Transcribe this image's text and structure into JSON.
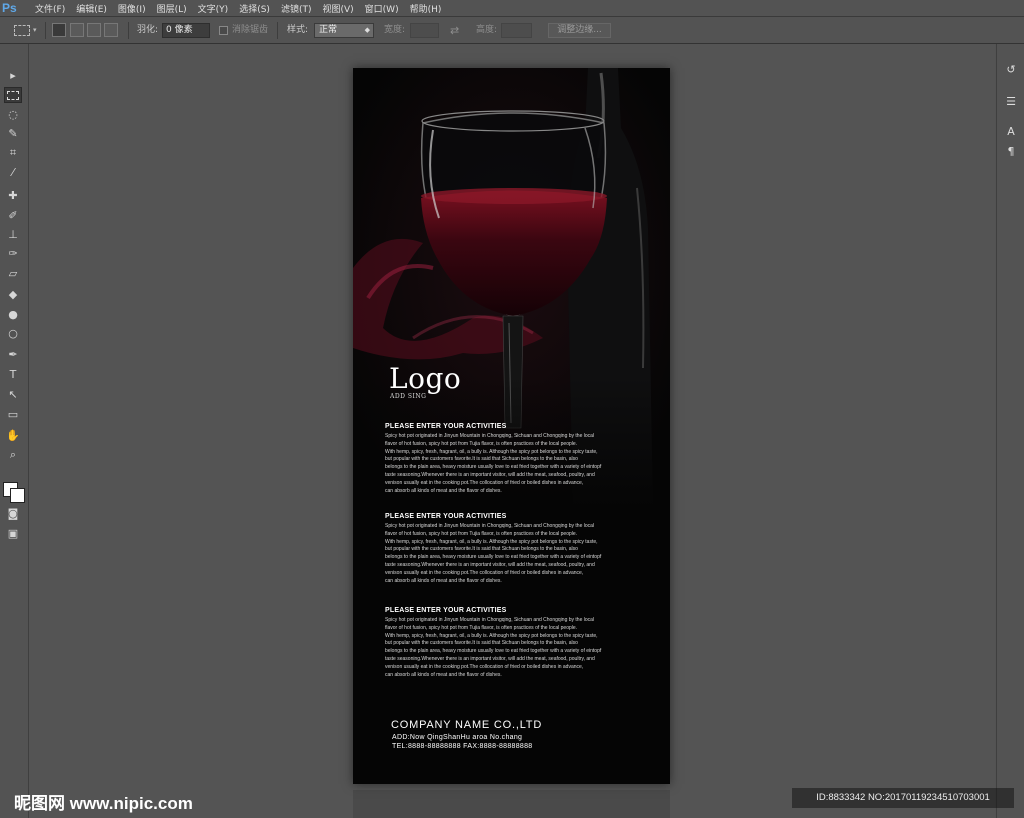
{
  "app": {
    "logo": "Ps"
  },
  "menu": [
    "文件(F)",
    "编辑(E)",
    "图像(I)",
    "图层(L)",
    "文字(Y)",
    "选择(S)",
    "滤镜(T)",
    "视图(V)",
    "窗口(W)",
    "帮助(H)"
  ],
  "options": {
    "feather_label": "羽化:",
    "feather_value": "0 像素",
    "antialias_label": "消除锯齿",
    "style_label": "样式:",
    "style_value": "正常",
    "width_label": "宽度:",
    "swap_icon": "⇄",
    "height_label": "高度:",
    "refine_edge_button": "调整边缘..."
  },
  "toolbar_icons": [
    "move-icon",
    "marquee-icon",
    "lasso-icon",
    "quick-select-icon",
    "crop-icon",
    "eyedropper-icon",
    "healing-brush-icon",
    "brush-icon",
    "clone-stamp-icon",
    "history-brush-icon",
    "eraser-icon",
    "paint-bucket-icon",
    "blur-icon",
    "dodge-icon",
    "pen-icon",
    "type-icon",
    "path-select-icon",
    "shape-icon",
    "hand-icon",
    "zoom-icon"
  ],
  "document": {
    "logo": "Logo",
    "logo_sub": "ADD SING",
    "blocks": [
      {
        "title": "PLEASE ENTER YOUR ACTIVITIES",
        "lines": [
          "Spicy hot pot originated in Jinyun Mountain in Chongqing, Sichuan and Chongqing by the local",
          "flavor of hot fusion, spicy hot pot from Tujia flavor, is often practices of the local people.",
          "With hemp, spicy, fresh, fragrant, oil, a bully is. Although the spicy pot belongs to the spicy taste,",
          "but popular with the customers favorite.It is said that Sichuan belongs to the basin, also",
          "belongs to the plain area, heavy moisture usually love to eat fried together with a variety of eintopf",
          "taste seasoning.Whenever there is an important visitor, will add the meat, seafood, poultry, and",
          "venison usually eat in the cooking pot.The collocation of fried or boiled dishes in advance,",
          "can absorb all kinds of meat and the flavor of dishes."
        ]
      },
      {
        "title": "PLEASE ENTER YOUR ACTIVITIES",
        "lines": [
          "Spicy hot pot originated in Jinyun Mountain in Chongqing, Sichuan and Chongqing by the local",
          "flavor of hot fusion, spicy hot pot from Tujia flavor, is often practices of the local people.",
          "With hemp, spicy, fresh, fragrant, oil, a bully is. Although the spicy pot belongs to the spicy taste,",
          "but popular with the customers favorite.It is said that Sichuan belongs to the basin, also",
          "belongs to the plain area, heavy moisture usually love to eat fried together with a variety of eintopf",
          "taste seasoning.Whenever there is an important visitor, will add the meat, seafood, poultry, and",
          "venison usually eat in the cooking pot.The collocation of fried or boiled dishes in advance,",
          "can absorb all kinds of meat and the flavor of dishes."
        ]
      },
      {
        "title": "PLEASE ENTER YOUR ACTIVITIES",
        "lines": [
          "Spicy hot pot originated in Jinyun Mountain in Chongqing, Sichuan and Chongqing by the local",
          "flavor of hot fusion, spicy hot pot from Tujia flavor, is often practices of the local people.",
          "With hemp, spicy, fresh, fragrant, oil, a bully is. Although the spicy pot belongs to the spicy taste,",
          "but popular with the customers favorite.It is said that Sichuan belongs to the basin, also",
          "belongs to the plain area, heavy moisture usually love to eat fried together with a variety of eintopf",
          "taste seasoning.Whenever there is an important visitor, will add the meat, seafood, poultry, and",
          "venison usually eat in the cooking pot.The collocation of fried or boiled dishes in advance,",
          "can absorb all kinds of meat and the flavor of dishes."
        ]
      }
    ],
    "company": "COMPANY NAME CO.,LTD",
    "address": "ADD:Now QingShanHu aroa No.chang",
    "tel": "TEL:8888-88888888  FAX:8888-88888888"
  },
  "watermark": {
    "left": "昵图网 www.nipic.com",
    "right": "ID:8833342 NO:20170119234510703001"
  },
  "colors": {
    "ui_bg": "#535353",
    "wine": "#5a0a12",
    "ps_blue": "#5fa8e8"
  }
}
